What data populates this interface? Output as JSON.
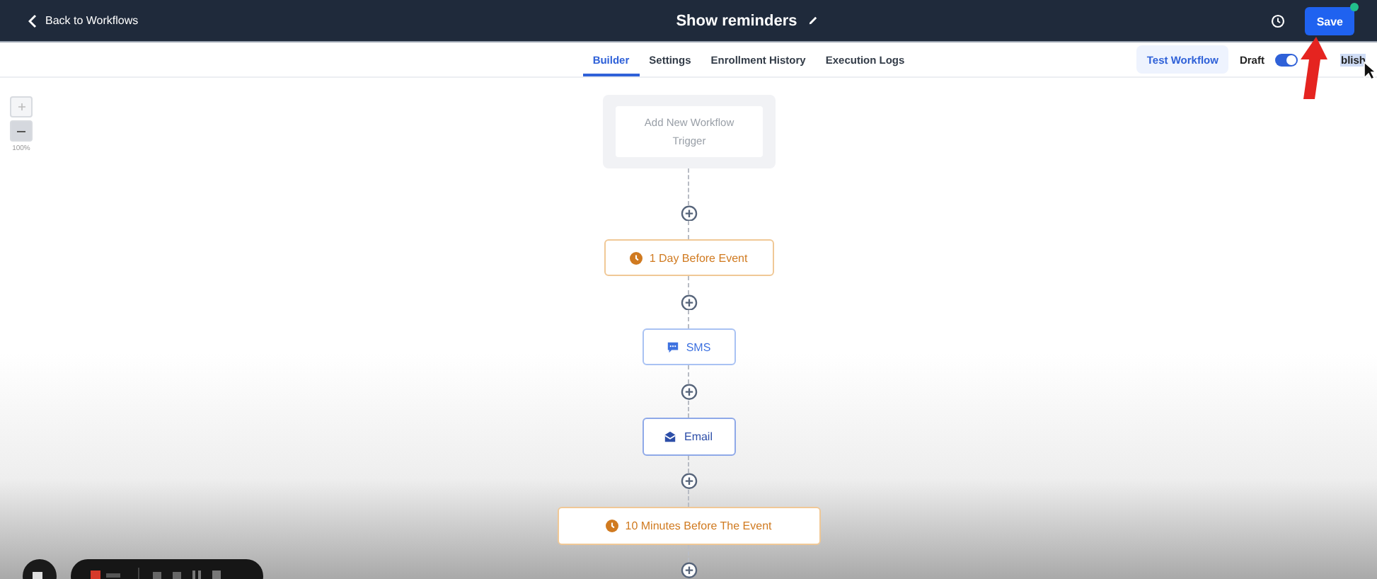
{
  "header": {
    "back_label": "Back to Workflows",
    "title": "Show reminders",
    "save_label": "Save",
    "save_unsaved": true
  },
  "tabs": [
    {
      "label": "Builder",
      "selected": true
    },
    {
      "label": "Settings",
      "selected": false
    },
    {
      "label": "Enrollment History",
      "selected": false
    },
    {
      "label": "Execution Logs",
      "selected": false
    }
  ],
  "actions": {
    "test_label": "Test Workflow",
    "draft_label": "Draft",
    "publish_label": "blish",
    "published": true
  },
  "zoom": {
    "reading": "100%"
  },
  "trigger": {
    "label": "Add New Workflow Trigger"
  },
  "nodes": [
    {
      "kind": "wait",
      "label": "1 Day Before Event"
    },
    {
      "kind": "sms",
      "label": "SMS"
    },
    {
      "kind": "email",
      "label": "Email"
    },
    {
      "kind": "wait",
      "label": "10 Minutes Before The Event"
    }
  ]
}
